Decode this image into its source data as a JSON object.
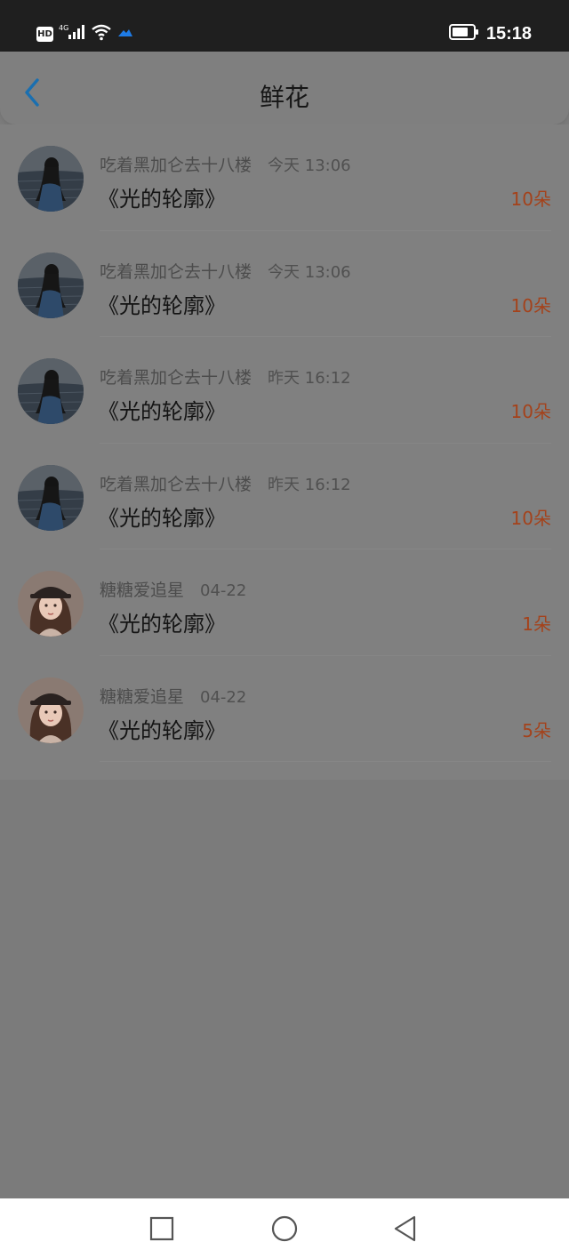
{
  "status_bar": {
    "hd_label": "HD",
    "network_label": "4G",
    "time": "15:18",
    "icons": [
      "hd-icon",
      "signal-icon",
      "wifi-icon",
      "cloud-icon",
      "battery-icon"
    ]
  },
  "header": {
    "title": "鲜花",
    "back_icon": "back-chevron-icon"
  },
  "colors": {
    "accent": "#1a6fb0",
    "count": "#a4421b",
    "overlay_bg": "#7b7b7b",
    "status_bar_bg": "#1f1f1f"
  },
  "flowers": [
    {
      "user": "吃着黑加仑去十八楼",
      "time": "今天 13:06",
      "song": "《光的轮廓》",
      "count": "10朵",
      "avatar": "avatar-girl-lake-image"
    },
    {
      "user": "吃着黑加仑去十八楼",
      "time": "今天 13:06",
      "song": "《光的轮廓》",
      "count": "10朵",
      "avatar": "avatar-girl-lake-image"
    },
    {
      "user": "吃着黑加仑去十八楼",
      "time": "昨天 16:12",
      "song": "《光的轮廓》",
      "count": "10朵",
      "avatar": "avatar-girl-lake-image"
    },
    {
      "user": "吃着黑加仑去十八楼",
      "time": "昨天 16:12",
      "song": "《光的轮廓》",
      "count": "10朵",
      "avatar": "avatar-girl-lake-image"
    },
    {
      "user": "糖糖爱追星",
      "time": "04-22",
      "song": "《光的轮廓》",
      "count": "1朵",
      "avatar": "avatar-girl-hat-image"
    },
    {
      "user": "糖糖爱追星",
      "time": "04-22",
      "song": "《光的轮廓》",
      "count": "5朵",
      "avatar": "avatar-girl-hat-image"
    }
  ],
  "nav_bar": {
    "buttons": [
      "recents-square-icon",
      "home-circle-icon",
      "back-triangle-icon"
    ]
  }
}
